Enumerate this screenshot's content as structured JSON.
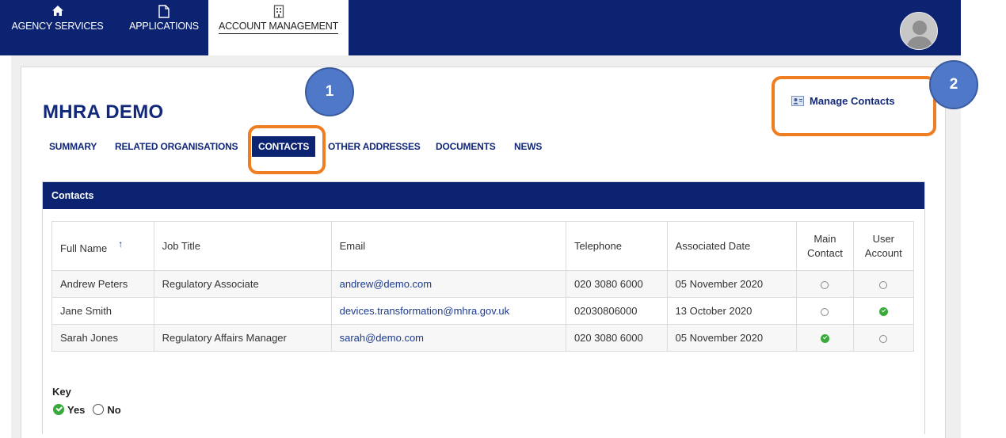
{
  "nav": {
    "items": [
      {
        "label": "AGENCY SERVICES",
        "icon": "home-icon"
      },
      {
        "label": "APPLICATIONS",
        "icon": "document-icon"
      },
      {
        "label": "ACCOUNT MANAGEMENT",
        "icon": "building-icon",
        "active": true
      }
    ]
  },
  "page": {
    "title": "MHRA DEMO",
    "manage_contacts": "Manage Contacts"
  },
  "tabs": [
    "SUMMARY",
    "RELATED ORGANISATIONS",
    "CONTACTS",
    "OTHER ADDRESSES",
    "DOCUMENTS",
    "NEWS"
  ],
  "active_tab": "CONTACTS",
  "callouts": [
    "1",
    "2"
  ],
  "colors": {
    "navy": "#0b2370",
    "callout_blue": "#4f79c8",
    "highlight_orange": "#ef7d22",
    "check_green": "#39a93a"
  },
  "contacts": {
    "heading": "Contacts",
    "columns": [
      "Full Name",
      "Job Title",
      "Email",
      "Telephone",
      "Associated Date",
      "Main Contact",
      "User Account"
    ],
    "rows": [
      {
        "name": "Andrew Peters",
        "job": "Regulatory Associate",
        "email": "andrew@demo.com",
        "phone": "020 3080 6000",
        "date": "05 November 2020",
        "main": false,
        "user": false
      },
      {
        "name": "Jane Smith",
        "job": "",
        "email": "devices.transformation@mhra.gov.uk",
        "phone": "02030806000",
        "date": "13 October 2020",
        "main": false,
        "user": true
      },
      {
        "name": "Sarah Jones",
        "job": "Regulatory Affairs Manager",
        "email": "sarah@demo.com",
        "phone": "020 3080 6000",
        "date": "05 November 2020",
        "main": true,
        "user": false
      }
    ]
  },
  "key": {
    "title": "Key",
    "yes": "Yes",
    "no": "No"
  }
}
